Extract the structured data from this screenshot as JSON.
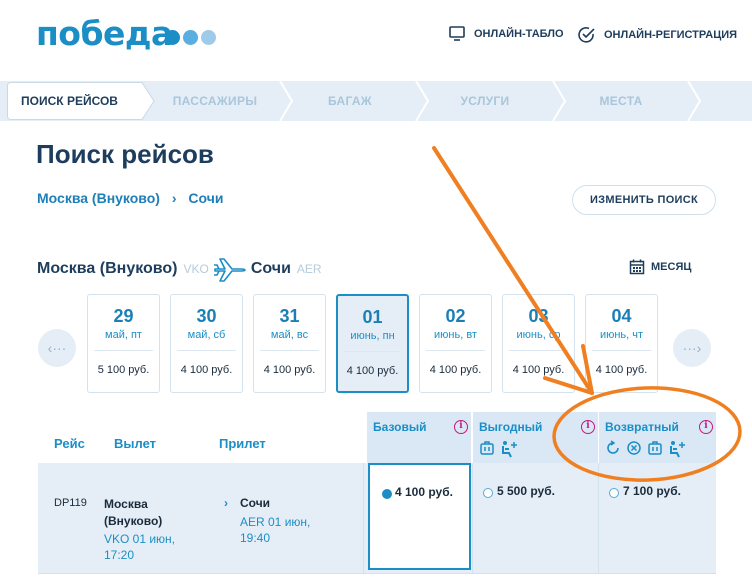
{
  "header": {
    "logo_text": "победа",
    "logo_dot_colors": [
      "#1b8ec6",
      "#5aaee0",
      "#9fcbeb"
    ],
    "links": [
      {
        "label": "ОНЛАЙН-ТАБЛО",
        "icon": "monitor-icon"
      },
      {
        "label": "ОНЛАЙН-РЕГИСТРАЦИЯ",
        "icon": "check-circle-icon"
      }
    ]
  },
  "steps": [
    {
      "label": "ПОИСК РЕЙСОВ",
      "active": true
    },
    {
      "label": "ПАССАЖИРЫ",
      "active": false
    },
    {
      "label": "БАГАЖ",
      "active": false
    },
    {
      "label": "УСЛУГИ",
      "active": false
    },
    {
      "label": "МЕСТА",
      "active": false
    }
  ],
  "page_title": "Поиск рейсов",
  "route_crumb": {
    "from": "Москва (Внуково)",
    "sep": "›",
    "to": "Сочи"
  },
  "change_search_label": "ИЗМЕНИТЬ ПОИСК",
  "direction": {
    "from": "Москва (Внуково)",
    "from_code": "VKO",
    "to": "Сочи",
    "to_code": "AER",
    "icon": "plane-icon"
  },
  "month_label": "МЕСЯЦ",
  "month_icon": "calendar-icon",
  "nav": {
    "prev": "‹···",
    "next": "···›"
  },
  "dates": [
    {
      "num": "29",
      "day": "май, пт",
      "price": "5 100 руб.",
      "selected": false
    },
    {
      "num": "30",
      "day": "май, сб",
      "price": "4 100 руб.",
      "selected": false
    },
    {
      "num": "31",
      "day": "май, вс",
      "price": "4 100 руб.",
      "selected": false
    },
    {
      "num": "01",
      "day": "июнь, пн",
      "price": "4 100 руб.",
      "selected": true
    },
    {
      "num": "02",
      "day": "июнь, вт",
      "price": "4 100 руб.",
      "selected": false
    },
    {
      "num": "03",
      "day": "июнь, ср",
      "price": "4 100 руб.",
      "selected": false
    },
    {
      "num": "04",
      "day": "июнь, чт",
      "price": "4 100 руб.",
      "selected": false
    }
  ],
  "table": {
    "col_flight": "Рейс",
    "col_departure": "Вылет",
    "col_arrival": "Прилет",
    "fares": [
      {
        "name": "Базовый",
        "icons": [],
        "price": "4 100 руб.",
        "selected": true
      },
      {
        "name": "Выгодный",
        "icons": [
          "bag-icon",
          "seat-plus-icon"
        ],
        "price": "5 500 руб.",
        "selected": false
      },
      {
        "name": "Возвратный",
        "icons": [
          "refresh-icon",
          "cancel-icon",
          "bag-icon",
          "seat-plus-icon"
        ],
        "price": "7 100 руб.",
        "selected": false
      }
    ],
    "rows": [
      {
        "flight": "DP119",
        "dep_city": "Москва (Внуково)",
        "dep_detail": "VKO 01 июн, 17:20",
        "arr_city": "Сочи",
        "arr_detail": "AER 01 июн, 19:40"
      }
    ]
  },
  "colors": {
    "brand": "#1b8ec6",
    "dark": "#1e3d5c",
    "accent_info": "#c41a7c",
    "annotation": "#f07f22"
  }
}
